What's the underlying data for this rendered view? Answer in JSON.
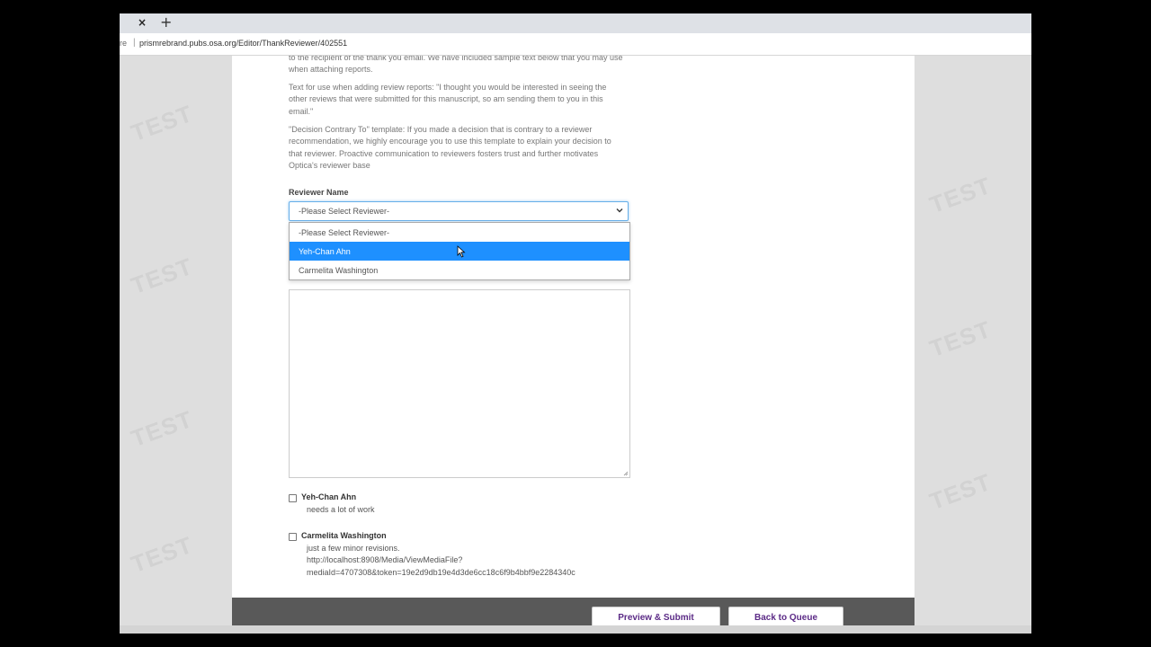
{
  "browser": {
    "tab_close": "×",
    "new_tab": "+",
    "address_prefix": "re",
    "url": "prismrebrand.pubs.osa.org/Editor/ThankReviewer/402551"
  },
  "watermark": "TEST",
  "instructions": {
    "p1": "to the recipient of the thank you email. We have included sample text below that you may use when attaching reports.",
    "p2": "Text for use when adding review reports: \"I thought you would be interested in seeing the other reviews that were submitted for this manuscript, so am sending them to you in this email.\"",
    "p3": "\"Decision Contrary To\" template: If you made a decision that is contrary to a reviewer recommendation, we highly encourage you to use this template to explain your decision to that reviewer. Proactive communication to reviewers fosters trust and further motivates Optica's reviewer base"
  },
  "reviewer_select": {
    "label": "Reviewer Name",
    "selected": "-Please Select Reviewer-",
    "options": [
      {
        "label": "-Please Select Reviewer-",
        "highlighted": false
      },
      {
        "label": "Yeh-Chan Ahn",
        "highlighted": true
      },
      {
        "label": "Carmelita Washington",
        "highlighted": false
      }
    ]
  },
  "message_textarea": {
    "value": ""
  },
  "reviews": [
    {
      "name": "Yeh-Chan Ahn",
      "checked": false,
      "comment_lines": [
        "needs a lot of work"
      ]
    },
    {
      "name": "Carmelita Washington",
      "checked": false,
      "comment_lines": [
        "just a few minor revisions.",
        "http://localhost:8908/Media/ViewMediaFile?",
        "mediaId=4707308&token=19e2d9db19e4d3de6cc18c6f9b4bbf9e2284340c"
      ]
    }
  ],
  "footer": {
    "preview_label": "Preview & Submit",
    "back_label": "Back to Queue"
  },
  "colors": {
    "highlight": "#1e90ff",
    "button_text": "#5b2a86",
    "footer_bg": "#595959"
  }
}
